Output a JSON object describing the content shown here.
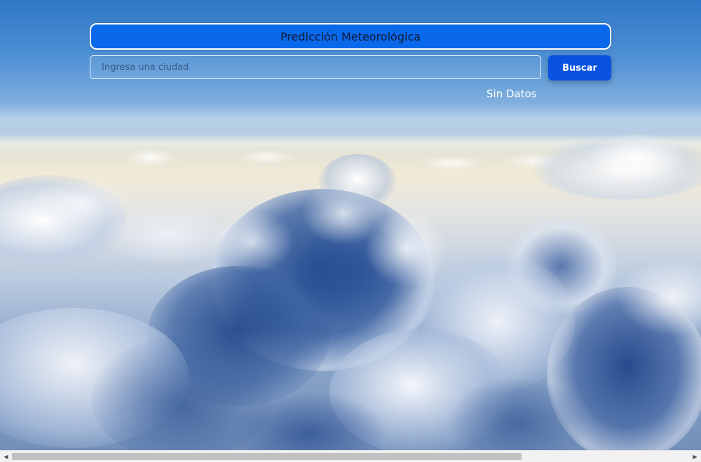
{
  "header": {
    "title": "Predicción Meteorológica"
  },
  "search": {
    "placeholder": "Ingresa una ciudad",
    "value": "",
    "button_label": "Buscar"
  },
  "status": {
    "text": "Sin Datos"
  },
  "background": {
    "description_icon": "sky-clouds-background"
  },
  "colors": {
    "title_bar": "#0a68ea",
    "button": "#0a52e0",
    "status_text": "#ffffff"
  },
  "scrollbar": {
    "left_icon": "scroll-left-arrow-icon",
    "right_icon": "scroll-right-arrow-icon"
  }
}
